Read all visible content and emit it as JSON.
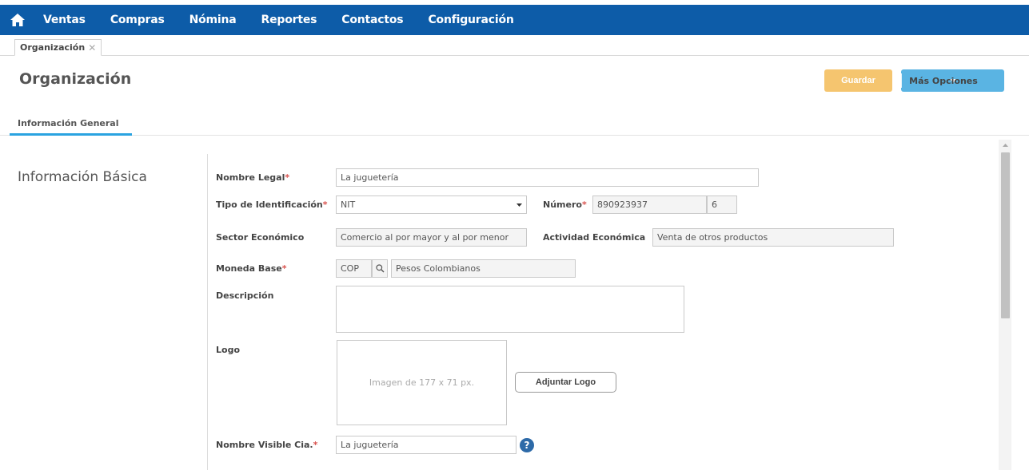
{
  "navbar": {
    "home_icon": "home-icon",
    "items": [
      "Ventas",
      "Compras",
      "Nómina",
      "Reportes",
      "Contactos",
      "Configuración"
    ],
    "background": "#0d5ca8"
  },
  "tabs": {
    "open": [
      {
        "label": "Organización",
        "close": "✕"
      }
    ]
  },
  "page": {
    "title": "Organización"
  },
  "actions": {
    "save_label": "Guardar",
    "more_label": "Más Opciones"
  },
  "section_tabs": [
    {
      "label": "Información General",
      "active": true
    }
  ],
  "form": {
    "group_title": "Información Básica",
    "required_mark": "*",
    "nombre_legal": {
      "label": "Nombre Legal",
      "value": "La juguetería"
    },
    "tipo_identificacion": {
      "label": "Tipo de Identificación",
      "value": "NIT"
    },
    "numero": {
      "label": "Número",
      "value": "890923937",
      "check_digit": "6"
    },
    "sector_economico": {
      "label": "Sector Económico",
      "value": "Comercio al por mayor y al por menor"
    },
    "actividad_economica": {
      "label": "Actividad Económica",
      "value": "Venta de otros productos"
    },
    "moneda_base": {
      "label": "Moneda Base",
      "code": "COP",
      "name": "Pesos Colombianos"
    },
    "descripcion": {
      "label": "Descripción",
      "value": ""
    },
    "logo": {
      "label": "Logo",
      "placeholder": "Imagen de 177 x 71 px.",
      "button": "Adjuntar Logo"
    },
    "nombre_visible": {
      "label": "Nombre Visible Cia.",
      "value": "La juguetería",
      "help": "?"
    }
  },
  "colors": {
    "accent": "#2aa3e0",
    "save": "#f5c56f",
    "more": "#5ab4e3",
    "required": "#d9534f"
  }
}
